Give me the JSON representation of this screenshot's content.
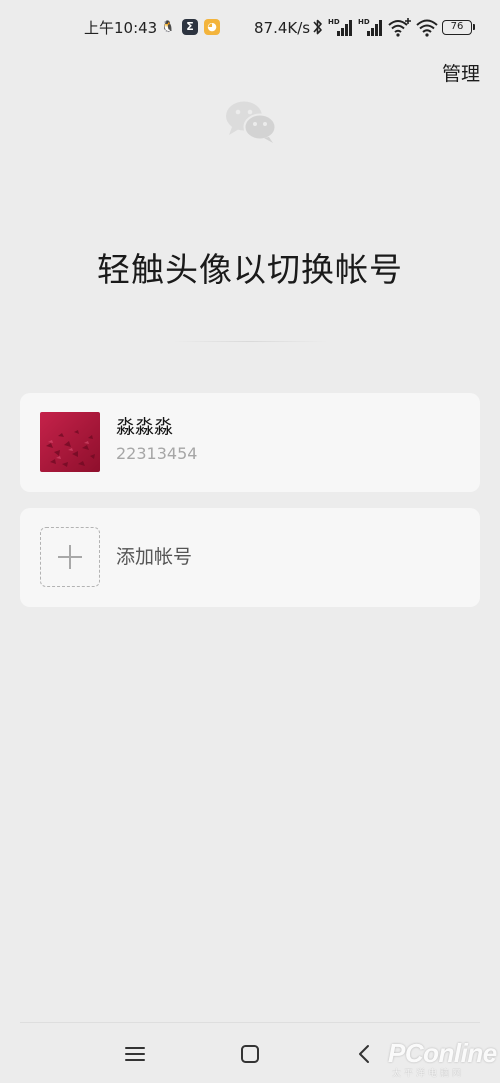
{
  "status_bar": {
    "time": "上午10:43",
    "network_speed": "87.4K/s",
    "battery_level": "76",
    "app_icons": [
      "qq-icon",
      "sigma-app-icon",
      "cat-app-icon"
    ],
    "right_icons": [
      "bluetooth-icon",
      "signal-hd-1-icon",
      "signal-hd-2-icon",
      "wifi-plus-icon",
      "wifi-icon",
      "battery-icon"
    ]
  },
  "header": {
    "manage_label": "管理",
    "logo": "wechat-logo-icon"
  },
  "main": {
    "title": "轻触头像以切换帐号",
    "account": {
      "name": "淼淼淼",
      "id": "22313454"
    },
    "add_account_label": "添加帐号"
  },
  "nav": {
    "buttons": [
      "menu-icon",
      "home-icon",
      "back-icon"
    ]
  },
  "watermark": {
    "text": "PConline",
    "sub": "太平洋电脑网"
  },
  "colors": {
    "background": "#ececec",
    "card": "#f7f7f7",
    "avatar_red": "#b01a3c",
    "muted_text": "#a6a6a6"
  }
}
